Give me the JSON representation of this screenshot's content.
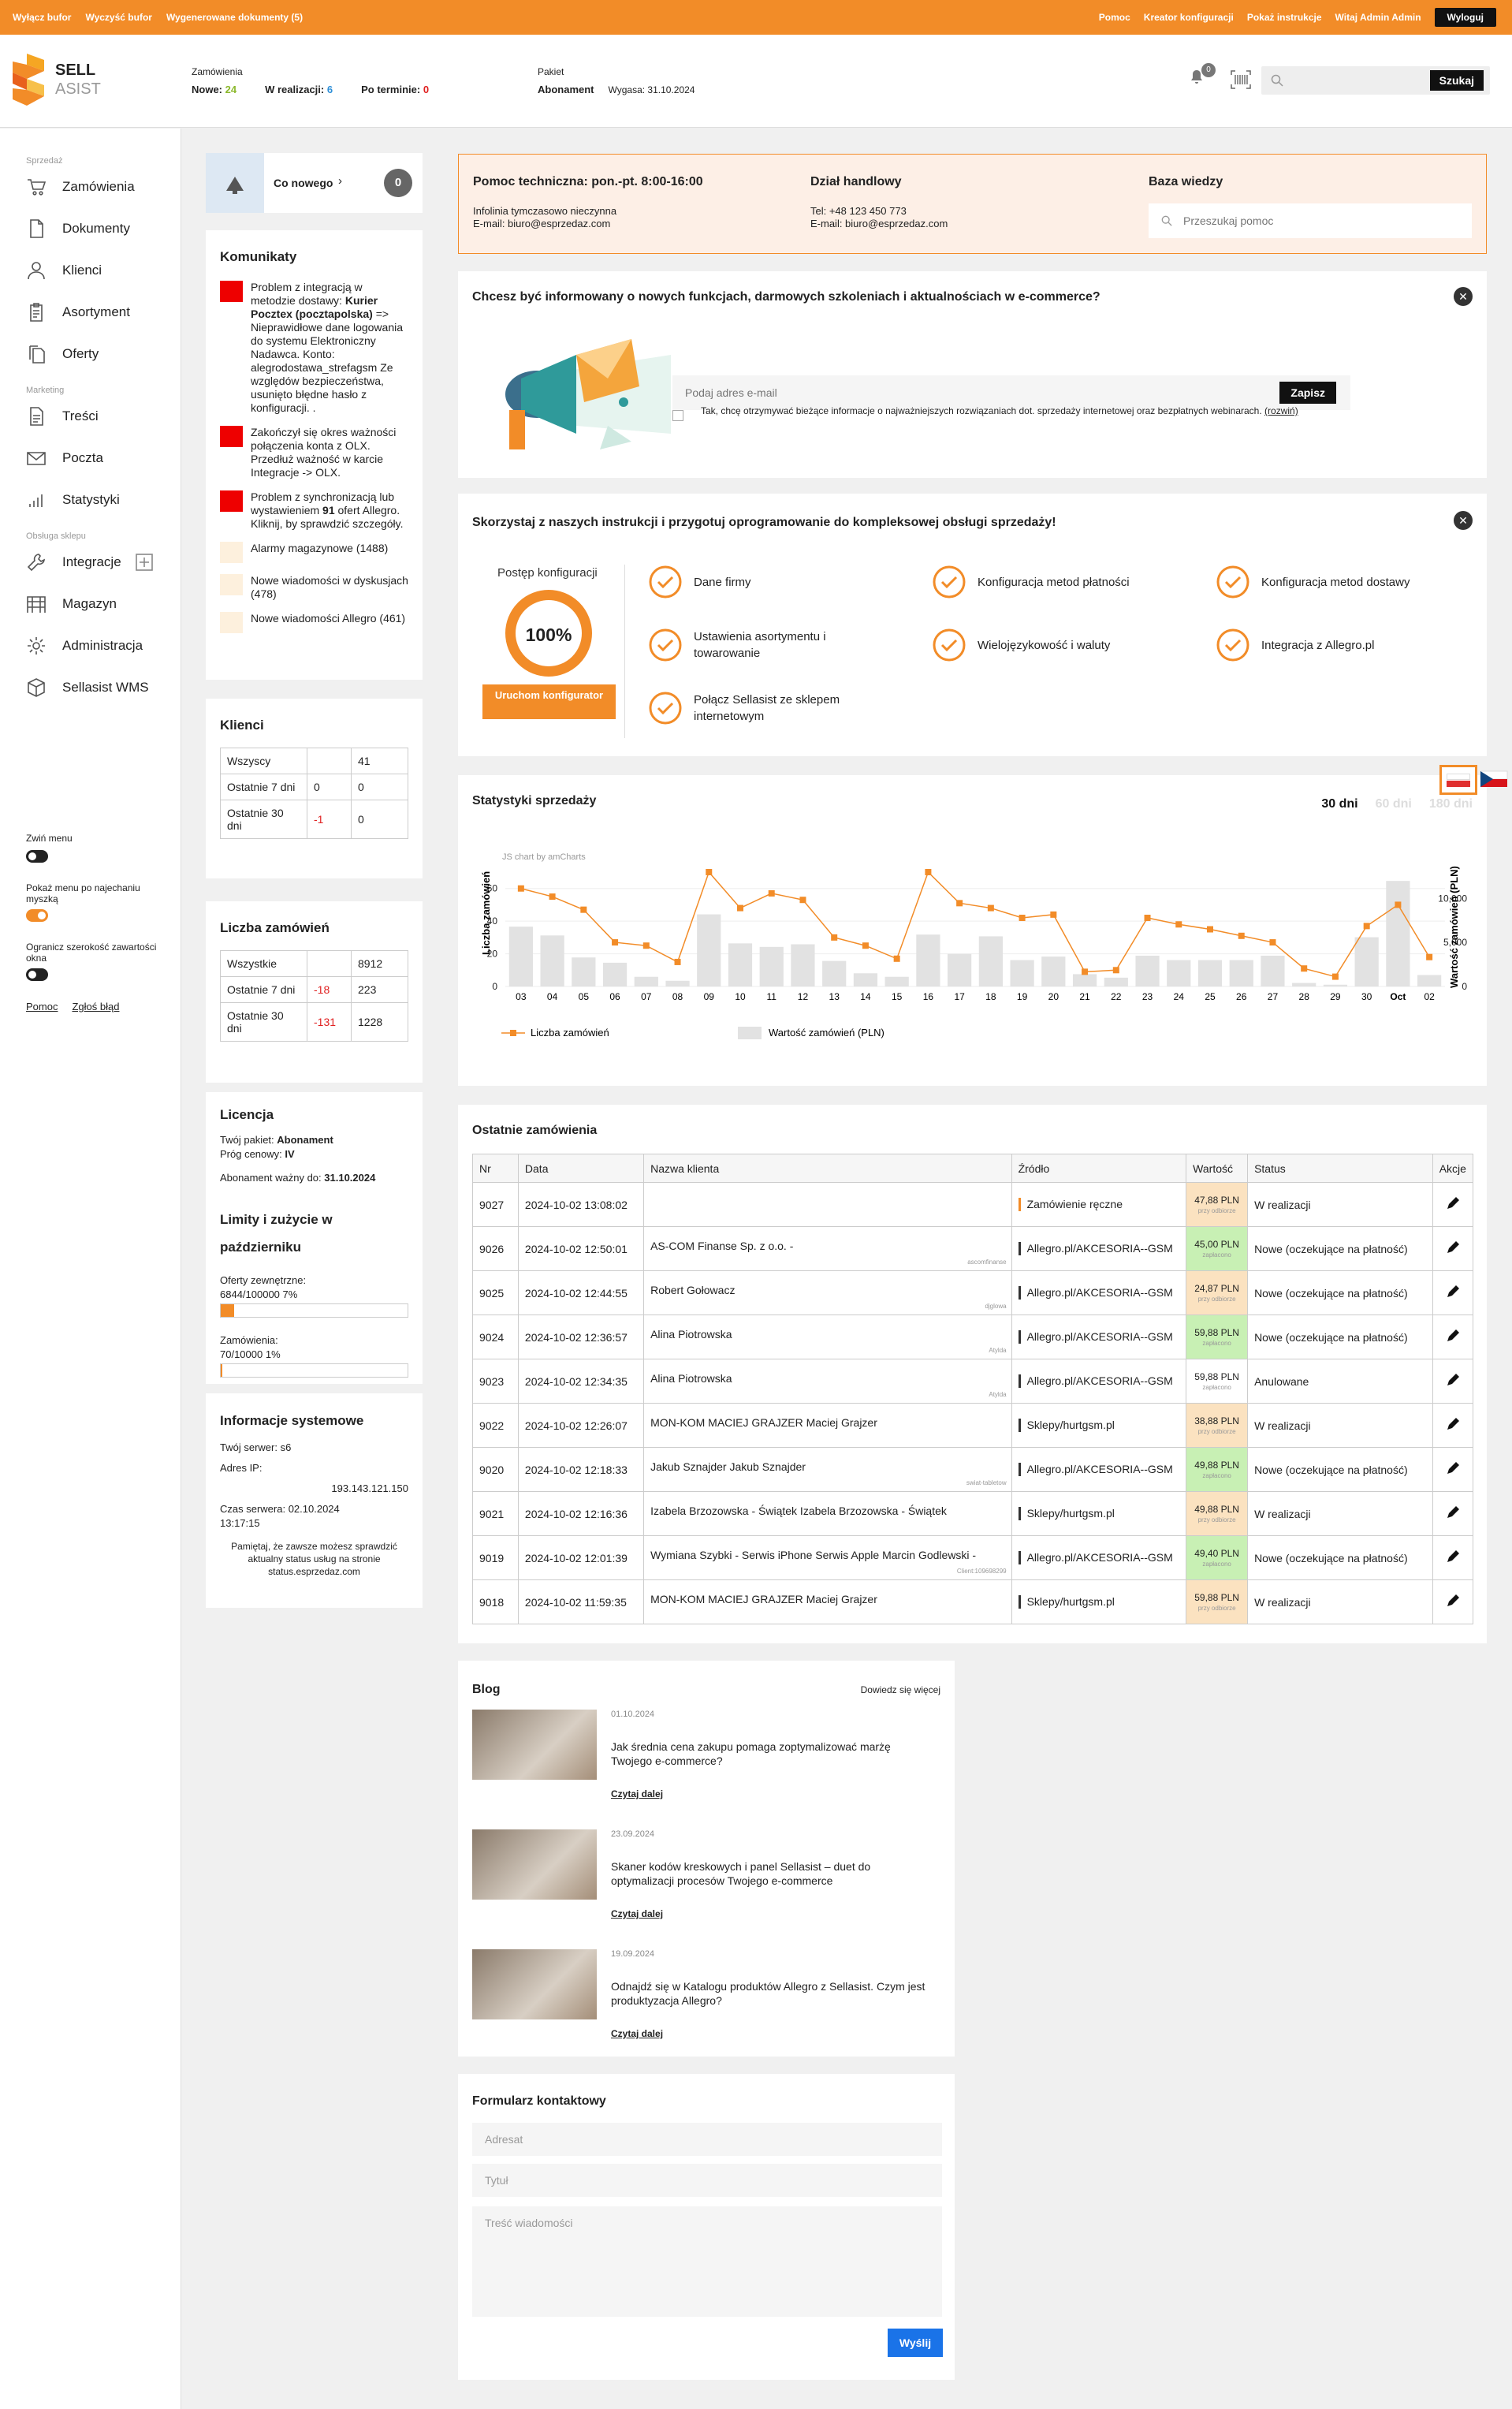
{
  "topbar": {
    "left": [
      "Wyłącz bufor",
      "Wyczyść bufor",
      "Wygenerowane dokumenty (5)"
    ],
    "right": [
      "Pomoc",
      "Kreator konfiguracji",
      "Pokaż instrukcje",
      "Witaj Admin Admin"
    ],
    "logout": "Wyloguj"
  },
  "logo": {
    "line1": "SELL",
    "line2": "ASIST"
  },
  "header": {
    "orders_label": "Zamówienia",
    "new_label": "Nowe:",
    "new_val": "24",
    "inprog_label": "W realizacji:",
    "inprog_val": "6",
    "overdue_label": "Po terminie:",
    "overdue_val": "0",
    "package_label": "Pakiet",
    "package_name": "Abonament",
    "expires": "Wygasa: 31.10.2024",
    "notif_count": "0",
    "search_btn": "Szukaj"
  },
  "sidebar": {
    "sections": [
      {
        "title": "Sprzedaż",
        "items": [
          "Zamówienia",
          "Dokumenty",
          "Klienci",
          "Asortyment",
          "Oferty"
        ]
      },
      {
        "title": "Marketing",
        "items": [
          "Treści",
          "Poczta",
          "Statystyki"
        ]
      },
      {
        "title": "Obsługa sklepu",
        "items": [
          "Integracje",
          "Magazyn",
          "Administracja",
          "Sellasist WMS"
        ]
      }
    ],
    "options": [
      "Zwiń menu",
      "Pokaż menu po najechaniu myszką",
      "Ogranicz szerokość zawartości okna"
    ],
    "links": [
      "Pomoc",
      "Zgłoś błąd"
    ]
  },
  "conew": {
    "label": "Co nowego",
    "count": "0"
  },
  "komunikaty": {
    "title": "Komunikaty",
    "items": [
      {
        "level": "red",
        "text": "Problem z integracją w metodzie dostawy: Kurier Pocztex (pocztapolska) => Nieprawidłowe dane logowania do systemu Elektroniczny Nadawca. Konto: alegrodostawa_strefagsm Ze względów bezpieczeństwa, usunięto błędne hasło z konfiguracji. ."
      },
      {
        "level": "red",
        "text": "Zakończył się okres ważności połączenia konta z OLX. Przedłuż ważność w karcie Integracje -> OLX."
      },
      {
        "level": "red",
        "text": "Problem z synchronizacją lub wystawieniem 91 ofert Allegro. Kliknij, by sprawdzić szczegóły."
      },
      {
        "level": "pale",
        "text": "Alarmy magazynowe (1488)"
      },
      {
        "level": "pale",
        "text": "Nowe wiadomości w dyskusjach (478)"
      },
      {
        "level": "pale",
        "text": "Nowe wiadomości Allegro (461)"
      }
    ]
  },
  "klienci": {
    "title": "Klienci",
    "rows": [
      {
        "label": "Wszyscy",
        "delta": "",
        "val": "41"
      },
      {
        "label": "Ostatnie 7 dni",
        "delta": "0",
        "val": "0"
      },
      {
        "label": "Ostatnie 30 dni",
        "delta": "-1",
        "val": "0"
      }
    ]
  },
  "liczba": {
    "title": "Liczba zamówień",
    "rows": [
      {
        "label": "Wszystkie",
        "delta": "",
        "val": "8912"
      },
      {
        "label": "Ostatnie 7 dni",
        "delta": "-18",
        "val": "223"
      },
      {
        "label": "Ostatnie 30 dni",
        "delta": "-131",
        "val": "1228"
      }
    ]
  },
  "licencja": {
    "title": "Licencja",
    "pkg_label": "Twój pakiet:",
    "pkg": "Abonament",
    "tier_label": "Próg cenowy:",
    "tier": "IV",
    "valid_label": "Abonament ważny do:",
    "valid": "31.10.2024",
    "limits_title": "Limity i zużycie w październiku",
    "ext_label": "Oferty zewnętrzne:",
    "ext_val": "6844/100000 7%",
    "ext_pct": 7,
    "ord_label": "Zamówienia:",
    "ord_val": "70/10000 1%",
    "ord_pct": 1
  },
  "sysinfo": {
    "title": "Informacje systemowe",
    "server": "Twój serwer: s6",
    "ip_label": "Adres IP:",
    "ip": "193.143.121.150",
    "time": "Czas serwera: 02.10.2024 13:17:15",
    "note": "Pamiętaj, że zawsze możesz sprawdzić aktualny status usług na stronie status.esprzedaz.com"
  },
  "help": {
    "support_title": "Pomoc techniczna: pon.-pt. 8:00-16:00",
    "support_l1": "Infolinia tymczasowo nieczynna",
    "support_l2": "E-mail: biuro@esprzedaz.com",
    "sales_title": "Dział handlowy",
    "sales_l1": "Tel: +48 123 450 773",
    "sales_l2": "E-mail: biuro@esprzedaz.com",
    "kb_title": "Baza wiedzy",
    "kb_placeholder": "Przeszukaj pomoc"
  },
  "newsletter": {
    "title": "Chcesz być informowany o nowych funkcjach, darmowych szkoleniach i aktualnościach w e-commerce?",
    "placeholder": "Podaj adres e-mail",
    "button": "Zapisz",
    "consent": "Tak, chcę otrzymywać bieżące informacje o najważniejszych rozwiązaniach dot. sprzedaży internetowej oraz bezpłatnych webinarach.",
    "consent_link": "(rozwiń)"
  },
  "config": {
    "title": "Skorzystaj z naszych instrukcji i przygotuj oprogramowanie do kompleksowej obsługi sprzedaży!",
    "progress_label": "Postęp konfiguracji",
    "progress": "100%",
    "button": "Uruchom konfigurator",
    "steps": [
      "Dane firmy",
      "Konfiguracja metod płatności",
      "Konfiguracja metod dostawy",
      "Ustawienia asortymentu i towarowanie",
      "Wielojęzykowość i waluty",
      "Integracja z Allegro.pl",
      "Połącz Sellasist ze sklepem internetowym"
    ]
  },
  "stats": {
    "title": "Statystyki sprzedaży",
    "ranges": [
      "30 dni",
      "60 dni",
      "180 dni"
    ],
    "watermark": "JS chart by amCharts"
  },
  "chart_data": {
    "type": "bar",
    "categories": [
      "03",
      "04",
      "05",
      "06",
      "07",
      "08",
      "09",
      "10",
      "11",
      "12",
      "13",
      "14",
      "15",
      "16",
      "17",
      "18",
      "19",
      "20",
      "21",
      "22",
      "23",
      "24",
      "25",
      "26",
      "27",
      "28",
      "29",
      "30",
      "Oct",
      "02"
    ],
    "series": [
      {
        "name": "Liczba zamówień",
        "type": "line",
        "axis": "left",
        "values": [
          60,
          55,
          47,
          27,
          25,
          15,
          70,
          48,
          57,
          53,
          30,
          25,
          17,
          70,
          51,
          48,
          42,
          44,
          9,
          10,
          42,
          38,
          35,
          31,
          27,
          11,
          6,
          37,
          50,
          18
        ]
      },
      {
        "name": "Wartość zamówień (PLN)",
        "type": "bar",
        "axis": "right",
        "values": [
          6800,
          5800,
          3300,
          2700,
          1100,
          650,
          8200,
          4900,
          4500,
          4800,
          2900,
          1500,
          1100,
          5900,
          3700,
          5700,
          3000,
          3400,
          1400,
          1000,
          3500,
          3000,
          3000,
          3000,
          3500,
          400,
          200,
          5600,
          12000,
          1300
        ]
      }
    ],
    "ylabel": "Liczba zamówień",
    "ylabel_right": "Wartość zamówień (PLN)",
    "ylim": [
      0,
      70
    ],
    "ylim_right": [
      0,
      13000
    ],
    "yticks": [
      "0",
      "20",
      "40",
      "60"
    ],
    "yticks_right": [
      "0",
      "5,000",
      "10,000"
    ],
    "legend": "bottom",
    "grid": true
  },
  "orders": {
    "title": "Ostatnie zamówienia",
    "headers": [
      "Nr",
      "Data",
      "Nazwa klienta",
      "Źródło",
      "Wartość",
      "Status",
      "Akcje"
    ],
    "rows": [
      {
        "nr": "9027",
        "date": "2024-10-02 13:08:02",
        "client": "",
        "sig": "",
        "source": "Zamówienie ręczne",
        "src_color": "orange",
        "value": "47,88 PLN",
        "vstatus": "przy odbiorze",
        "vclass": "unpaid",
        "status": "W realizacji"
      },
      {
        "nr": "9026",
        "date": "2024-10-02 12:50:01",
        "client": "AS-COM Finanse Sp. z o.o. -",
        "sig": "ascomfinanse",
        "source": "Allegro.pl/AKCESORIA--GSM",
        "src_color": "",
        "value": "45,00 PLN",
        "vstatus": "zapłacono",
        "vclass": "paid",
        "status": "Nowe (oczekujące na płatność)"
      },
      {
        "nr": "9025",
        "date": "2024-10-02 12:44:55",
        "client": "Robert Gołowacz",
        "sig": "djglowa",
        "source": "Allegro.pl/AKCESORIA--GSM",
        "src_color": "",
        "value": "24,87 PLN",
        "vstatus": "przy odbiorze",
        "vclass": "unpaid",
        "status": "Nowe (oczekujące na płatność)"
      },
      {
        "nr": "9024",
        "date": "2024-10-02 12:36:57",
        "client": "Alina Piotrowska",
        "sig": "Atylda",
        "source": "Allegro.pl/AKCESORIA--GSM",
        "src_color": "",
        "value": "59,88 PLN",
        "vstatus": "zapłacono",
        "vclass": "paid",
        "status": "Nowe (oczekujące na płatność)"
      },
      {
        "nr": "9023",
        "date": "2024-10-02 12:34:35",
        "client": "Alina Piotrowska",
        "sig": "Atylda",
        "source": "Allegro.pl/AKCESORIA--GSM",
        "src_color": "",
        "value": "59,88 PLN",
        "vstatus": "zapłacono",
        "vclass": "none",
        "status": "Anulowane"
      },
      {
        "nr": "9022",
        "date": "2024-10-02 12:26:07",
        "client": "MON-KOM MACIEJ GRAJZER Maciej Grajzer",
        "sig": "",
        "source": "Sklepy/hurtgsm.pl",
        "src_color": "",
        "value": "38,88 PLN",
        "vstatus": "przy odbiorze",
        "vclass": "unpaid",
        "status": "W realizacji"
      },
      {
        "nr": "9020",
        "date": "2024-10-02 12:18:33",
        "client": "Jakub Sznajder Jakub Sznajder",
        "sig": "swiat-tabletow",
        "source": "Allegro.pl/AKCESORIA--GSM",
        "src_color": "",
        "value": "49,88 PLN",
        "vstatus": "zapłacono",
        "vclass": "paid",
        "status": "Nowe (oczekujące na płatność)"
      },
      {
        "nr": "9021",
        "date": "2024-10-02 12:16:36",
        "client": "Izabela Brzozowska - Świątek Izabela Brzozowska - Świątek",
        "sig": "",
        "source": "Sklepy/hurtgsm.pl",
        "src_color": "",
        "value": "49,88 PLN",
        "vstatus": "przy odbiorze",
        "vclass": "unpaid",
        "status": "W realizacji"
      },
      {
        "nr": "9019",
        "date": "2024-10-02 12:01:39",
        "client": "Wymiana Szybki - Serwis iPhone Serwis Apple Marcin Godlewski -",
        "sig": "Client:109698299",
        "source": "Allegro.pl/AKCESORIA--GSM",
        "src_color": "",
        "value": "49,40 PLN",
        "vstatus": "zapłacono",
        "vclass": "paid",
        "status": "Nowe (oczekujące na płatność)"
      },
      {
        "nr": "9018",
        "date": "2024-10-02 11:59:35",
        "client": "MON-KOM MACIEJ GRAJZER Maciej Grajzer",
        "sig": "",
        "source": "Sklepy/hurtgsm.pl",
        "src_color": "",
        "value": "59,88 PLN",
        "vstatus": "przy odbiorze",
        "vclass": "unpaid",
        "status": "W realizacji"
      }
    ]
  },
  "blog": {
    "title": "Blog",
    "more": "Dowiedz się więcej",
    "read": "Czytaj dalej",
    "items": [
      {
        "date": "01.10.2024",
        "title": "Jak średnia cena zakupu pomaga zoptymalizować marżę Twojego e-commerce?"
      },
      {
        "date": "23.09.2024",
        "title": "Skaner kodów kreskowych i panel Sellasist – duet do optymalizacji procesów Twojego e-commerce"
      },
      {
        "date": "19.09.2024",
        "title": "Odnajdź się w Katalogu produktów Allegro z Sellasist. Czym jest produktyzacja Allegro?"
      }
    ]
  },
  "contact": {
    "title": "Formularz kontaktowy",
    "addr": "Adresat",
    "subj": "Tytuł",
    "msg": "Treść wiadomości",
    "send": "Wyślij"
  },
  "colors": {
    "accent": "#f28c28",
    "paid": "#c8f0b4",
    "unpaid": "#fbe2c0",
    "link": "#1a73e8"
  }
}
